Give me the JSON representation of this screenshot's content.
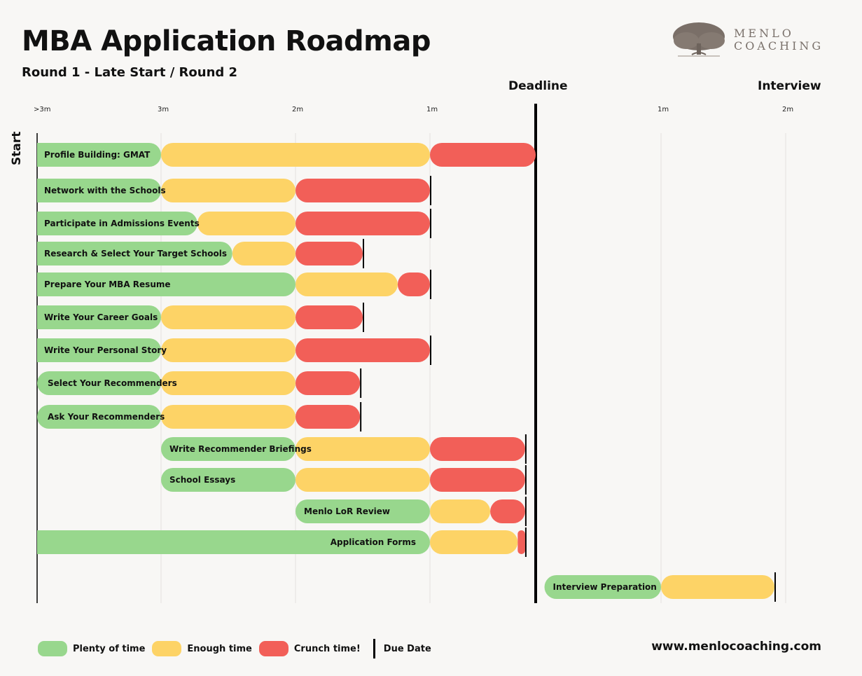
{
  "header": {
    "title": "MBA Application Roadmap",
    "subtitle": "Round 1 - Late Start / Round 2"
  },
  "logo": {
    "line1": "MENLO",
    "line2": "COACHING",
    "icon": "oak-tree-icon"
  },
  "footer": {
    "url": "www.menlocoaching.com"
  },
  "colors": {
    "plenty": "#98d78d",
    "enough": "#fdd366",
    "crunch": "#f25f58",
    "due": "#000000",
    "grid": "#e4e2df"
  },
  "chart_data": {
    "type": "gantt",
    "title": "MBA Application Roadmap",
    "subtitle": "Round 1 - Late Start / Round 2",
    "units": "months relative to application deadline (negative = before deadline)",
    "xlim": [
      -4,
      2.3
    ],
    "grid": true,
    "start_label": "Start",
    "milestones": [
      {
        "label": "Deadline",
        "x": 0
      },
      {
        "label": "Interview",
        "x": 2
      }
    ],
    "ticks": [
      {
        "x": -4,
        "label": ">3m"
      },
      {
        "x": -3,
        "label": "3m"
      },
      {
        "x": -2,
        "label": "2m"
      },
      {
        "x": -1,
        "label": "1m"
      },
      {
        "x": 1,
        "label": "1m"
      },
      {
        "x": 2,
        "label": "2m"
      }
    ],
    "legend": [
      {
        "key": "plenty",
        "label": "Plenty of time"
      },
      {
        "key": "enough",
        "label": "Enough time"
      },
      {
        "key": "crunch",
        "label": "Crunch time!"
      },
      {
        "key": "due",
        "label": "Due Date"
      }
    ],
    "legend_position": "bottom-left",
    "tasks": [
      {
        "name": "Profile Building: GMAT",
        "plenty": [
          -4,
          -3
        ],
        "enough": [
          -3,
          -1
        ],
        "crunch": [
          -1,
          0
        ],
        "due": null,
        "label_align": "left"
      },
      {
        "name": "Network with the Schools",
        "plenty": [
          -4,
          -3
        ],
        "enough": [
          -3,
          -2
        ],
        "crunch": [
          -2,
          -1
        ],
        "due": -1,
        "label_align": "left"
      },
      {
        "name": "Participate in Admissions Events",
        "plenty": [
          -4,
          -2.73
        ],
        "enough": [
          -2.73,
          -2
        ],
        "crunch": [
          -2,
          -1
        ],
        "due": -1,
        "label_align": "left"
      },
      {
        "name": "Research & Select Your Target Schools",
        "plenty": [
          -4,
          -2.47
        ],
        "enough": [
          -2.47,
          -2
        ],
        "crunch": [
          -2,
          -1.5
        ],
        "due": -1.5,
        "label_align": "left"
      },
      {
        "name": "Prepare Your MBA Resume",
        "plenty": [
          -4,
          -2
        ],
        "enough": [
          -2,
          -1.24
        ],
        "crunch": [
          -1.24,
          -1
        ],
        "due": -1,
        "label_align": "left"
      },
      {
        "name": "Write Your Career Goals",
        "plenty": [
          -4,
          -3
        ],
        "enough": [
          -3,
          -2
        ],
        "crunch": [
          -2,
          -1.5
        ],
        "due": -1.5,
        "label_align": "left"
      },
      {
        "name": "Write Your Personal Story",
        "plenty": [
          -4,
          -3
        ],
        "enough": [
          -3,
          -2
        ],
        "crunch": [
          -2,
          -1
        ],
        "due": -1,
        "label_align": "left"
      },
      {
        "name": "Select Your Recommenders",
        "plenty": [
          -4,
          -3
        ],
        "enough": [
          -3,
          -2
        ],
        "crunch": [
          -2,
          -1.52
        ],
        "due": -1.52,
        "label_align": "left",
        "pill": true
      },
      {
        "name": "Ask Your Recommenders",
        "plenty": [
          -4,
          -3
        ],
        "enough": [
          -3,
          -2
        ],
        "crunch": [
          -2,
          -1.52
        ],
        "due": -1.52,
        "label_align": "left",
        "pill": true
      },
      {
        "name": "Write Recommender Briefings",
        "plenty": [
          -3,
          -2
        ],
        "enough": [
          -2,
          -1
        ],
        "crunch": [
          -1,
          -0.1
        ],
        "due": -0.1,
        "label_align": "left",
        "pill": true
      },
      {
        "name": "School Essays",
        "plenty": [
          -3,
          -2
        ],
        "enough": [
          -2,
          -1
        ],
        "crunch": [
          -1,
          -0.1
        ],
        "due": -0.1,
        "label_align": "left",
        "pill": true
      },
      {
        "name": "Menlo LoR Review",
        "plenty": [
          -2,
          -1
        ],
        "enough": [
          -1,
          -0.43
        ],
        "crunch": [
          -0.43,
          -0.1
        ],
        "due": -0.1,
        "label_align": "left",
        "pill": true
      },
      {
        "name": "Application Forms",
        "plenty": [
          -4,
          -1
        ],
        "enough": [
          -1,
          -0.17
        ],
        "crunch": [
          -0.17,
          -0.1
        ],
        "due": -0.1,
        "label_align": "right"
      },
      {
        "name": "Interview Preparation",
        "plenty": [
          0.07,
          1
        ],
        "enough": [
          1,
          1.91
        ],
        "crunch": null,
        "due": 1.91,
        "label_align": "left",
        "pill": true
      }
    ]
  }
}
